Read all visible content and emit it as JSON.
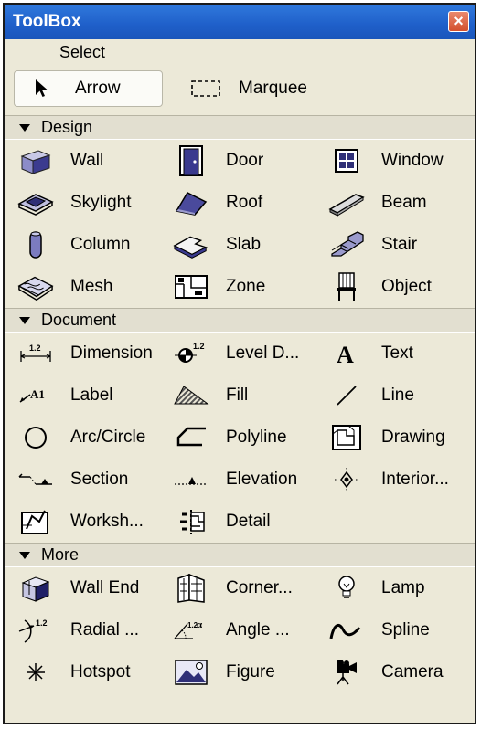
{
  "window": {
    "title": "ToolBox",
    "close_label": "×"
  },
  "select": {
    "label": "Select",
    "tools": [
      {
        "label": "Arrow",
        "icon": "arrow-cursor-icon"
      },
      {
        "label": "Marquee",
        "icon": "marquee-icon"
      }
    ]
  },
  "design": {
    "label": "Design",
    "tools": [
      {
        "label": "Wall",
        "icon": "wall-icon"
      },
      {
        "label": "Door",
        "icon": "door-icon"
      },
      {
        "label": "Window",
        "icon": "window-icon"
      },
      {
        "label": "Skylight",
        "icon": "skylight-icon"
      },
      {
        "label": "Roof",
        "icon": "roof-icon"
      },
      {
        "label": "Beam",
        "icon": "beam-icon"
      },
      {
        "label": "Column",
        "icon": "column-icon"
      },
      {
        "label": "Slab",
        "icon": "slab-icon"
      },
      {
        "label": "Stair",
        "icon": "stair-icon"
      },
      {
        "label": "Mesh",
        "icon": "mesh-icon"
      },
      {
        "label": "Zone",
        "icon": "zone-icon"
      },
      {
        "label": "Object",
        "icon": "object-icon"
      }
    ]
  },
  "document": {
    "label": "Document",
    "tools": [
      {
        "label": "Dimension",
        "icon": "dimension-icon"
      },
      {
        "label": "Level D...",
        "icon": "level-dimension-icon"
      },
      {
        "label": "Text",
        "icon": "text-icon"
      },
      {
        "label": "Label",
        "icon": "label-icon"
      },
      {
        "label": "Fill",
        "icon": "fill-icon"
      },
      {
        "label": "Line",
        "icon": "line-icon"
      },
      {
        "label": "Arc/Circle",
        "icon": "arc-circle-icon"
      },
      {
        "label": "Polyline",
        "icon": "polyline-icon"
      },
      {
        "label": "Drawing",
        "icon": "drawing-icon"
      },
      {
        "label": "Section",
        "icon": "section-icon"
      },
      {
        "label": "Elevation",
        "icon": "elevation-icon"
      },
      {
        "label": "Interior...",
        "icon": "interior-elevation-icon"
      },
      {
        "label": "Worksh...",
        "icon": "worksheet-icon"
      },
      {
        "label": "Detail",
        "icon": "detail-icon"
      }
    ]
  },
  "more": {
    "label": "More",
    "tools": [
      {
        "label": "Wall End",
        "icon": "wall-end-icon"
      },
      {
        "label": "Corner...",
        "icon": "corner-window-icon"
      },
      {
        "label": "Lamp",
        "icon": "lamp-icon"
      },
      {
        "label": "Radial ...",
        "icon": "radial-dimension-icon"
      },
      {
        "label": "Angle ...",
        "icon": "angle-dimension-icon"
      },
      {
        "label": "Spline",
        "icon": "spline-icon"
      },
      {
        "label": "Hotspot",
        "icon": "hotspot-icon"
      },
      {
        "label": "Figure",
        "icon": "figure-icon"
      },
      {
        "label": "Camera",
        "icon": "camera-icon"
      }
    ]
  },
  "glyphs": {
    "dim_sup": "1.2",
    "label_glyph": "A1",
    "angle_glyph": "α",
    "text_glyph": "A"
  },
  "colors": {
    "titlebar": "#1f5fc9",
    "panel": "#ece9d8",
    "header": "#e2dfd0",
    "close": "#d4502d"
  }
}
